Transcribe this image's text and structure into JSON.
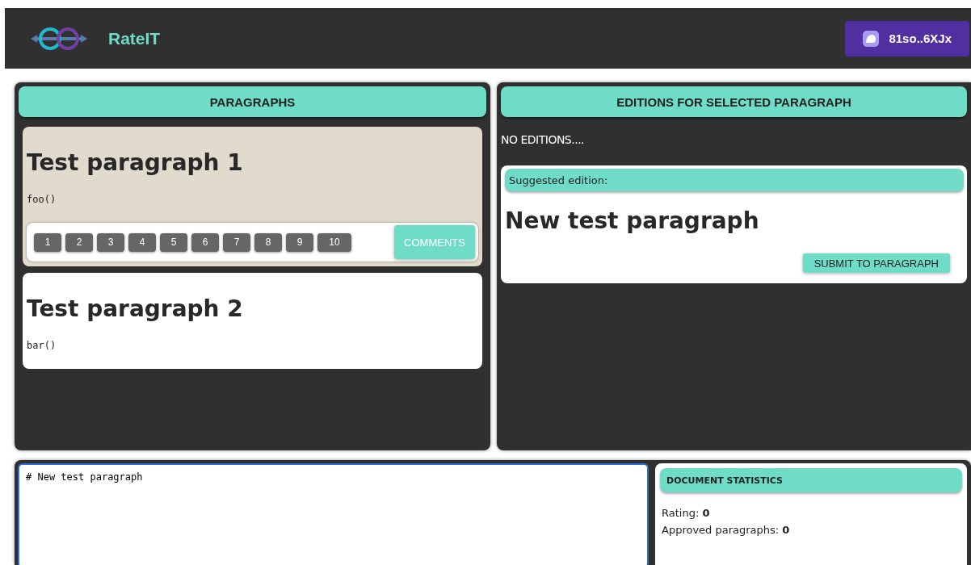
{
  "header": {
    "app_name": "RateIT",
    "wallet": "81so..6XJx"
  },
  "paragraphs_panel": {
    "title": "PARAGRAPHS",
    "items": [
      {
        "title": "Test paragraph 1",
        "code": "foo()",
        "selected": true
      },
      {
        "title": "Test paragraph 2",
        "code": "bar()",
        "selected": false
      }
    ],
    "rating_buttons": [
      "1",
      "2",
      "3",
      "4",
      "5",
      "6",
      "7",
      "8",
      "9",
      "10"
    ],
    "comments_button": "COMMENTS"
  },
  "editions_panel": {
    "title": "EDITIONS FOR SELECTED PARAGRAPH",
    "empty_text": "NO EDITIONS....",
    "suggested_label": "Suggested edition:",
    "suggested_title": "New test paragraph",
    "submit_button": "SUBMIT TO PARAGRAPH"
  },
  "editor": {
    "value": "# New test paragraph"
  },
  "statistics": {
    "title": "DOCUMENT STATISTICS",
    "rows": [
      {
        "label": "Rating:",
        "value": "0"
      },
      {
        "label": "Approved paragraphs:",
        "value": "0"
      }
    ]
  }
}
